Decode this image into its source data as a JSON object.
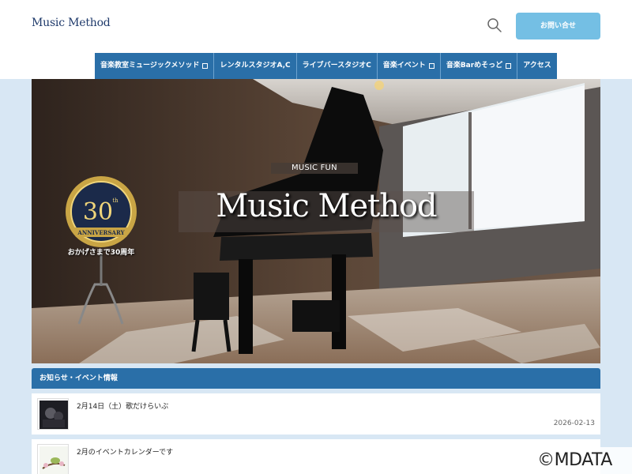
{
  "header": {
    "logo": "Music Method",
    "search_icon": "search-icon",
    "contact_label": "お問い合せ"
  },
  "nav": {
    "items": [
      {
        "label": "音楽教室ミュージックメソッド",
        "has_dropdown": true
      },
      {
        "label": "レンタルスタジオA,C",
        "has_dropdown": false
      },
      {
        "label": "ライブバースタジオC",
        "has_dropdown": false
      },
      {
        "label": "音楽イベント",
        "has_dropdown": true
      },
      {
        "label": "音楽Barめそっど",
        "has_dropdown": true
      },
      {
        "label": "アクセス",
        "has_dropdown": false
      }
    ]
  },
  "hero": {
    "subtitle": "MUSIC FUN",
    "title": "Music Method",
    "badge_number": "30",
    "badge_sup": "th",
    "badge_ribbon": "ANNIVERSARY",
    "badge_caption": "おかげさまで30周年"
  },
  "news": {
    "header": "お知らせ・イベント情報",
    "items": [
      {
        "title": "2月14日（土）歌だけらいぶ",
        "date": "2026-02-13"
      },
      {
        "title": "2月のイベントカレンダーです",
        "date": ""
      }
    ]
  },
  "watermark": "©MDATA",
  "colors": {
    "nav_bg": "#2a6fa8",
    "contact_bg": "#74bfe4",
    "page_bg": "#d8e7f4",
    "logo": "#1f3a6b"
  }
}
